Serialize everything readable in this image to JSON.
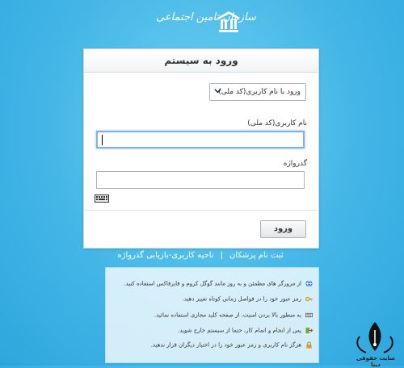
{
  "header": {
    "org_name": "سازمان تامین اجتماعی",
    "logo_icon": "ssa-emblem-icon"
  },
  "login": {
    "title": "ورود به سیستم",
    "login_type_selected": "ورود با نام کاربری(کد ملی)",
    "username_label": "نام کاربری(کد ملی)",
    "username_value": "",
    "password_label": "گذرواژه",
    "password_value": "",
    "submit_label": "ورود"
  },
  "links": {
    "register": "ثبت نام پزشکان",
    "separator": "|",
    "recover": "ناحیه کاربری-بازیابی گذرواژه"
  },
  "tips": [
    {
      "icon": "browser-icon",
      "text": "از مرورگر های مطمئن و به روز مانند گوگل کروم و فایرفاکس استفاده کنید."
    },
    {
      "icon": "key-icon",
      "text": "رمز عبور خود را در فواصل زمانی کوتاه تغییر دهید."
    },
    {
      "icon": "keyboard-icon",
      "text": "به منظور بالا بردن امنیت، از صفحه کلید مجازی استفاده نمائید."
    },
    {
      "icon": "exit-icon",
      "text": "پس از انجام و اتمام کار، حتما از سیستم خارج شوید."
    },
    {
      "icon": "lock-icon",
      "text": "هرگز نام کاربری و رمز عبور خود را در اختیار دیگران قرار ندهید."
    }
  ],
  "watermark": {
    "text": "سایت حقوقی دینا"
  },
  "colors": {
    "background": "#43b6e6",
    "card": "#ffffff",
    "focus": "#7fb3e8"
  }
}
